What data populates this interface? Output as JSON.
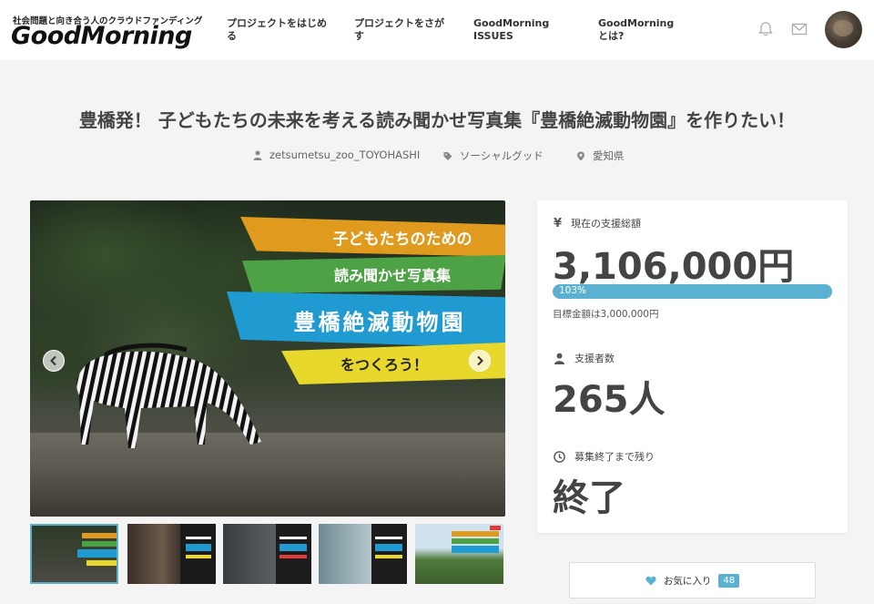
{
  "header": {
    "tagline": "社会問題と向き合う人のクラウドファンディング",
    "logo": "GoodMorning",
    "nav": [
      "プロジェクトをはじめる",
      "プロジェクトをさがす",
      "GoodMorning ISSUES",
      "GoodMorningとは?"
    ]
  },
  "project": {
    "title": "豊橋発！ 子どもたちの未来を考える読み聞かせ写真集『豊橋絶滅動物園』を作りたい！",
    "author": "zetsumetsu_zoo_TOYOHASHI",
    "category": "ソーシャルグッド",
    "location": "愛知県"
  },
  "hero": {
    "banner1": "子どもたちのための",
    "banner2": "読み聞かせ写真集",
    "banner3": "豊橋絶滅動物園",
    "banner4": "をつくろう！"
  },
  "stats": {
    "currency_symbol": "¥",
    "total_label": "現在の支援総額",
    "total_value": "3,106,000円",
    "progress_percent": 103,
    "progress_text": "103%",
    "target_text": "目標金額は3,000,000円",
    "backers_label": "支援者数",
    "backers_value": "265人",
    "remaining_label": "募集終了まで残り",
    "remaining_value": "終了"
  },
  "favorite": {
    "label": "お気に入り",
    "count": "48"
  },
  "colors": {
    "accent": "#5ab1d0"
  }
}
